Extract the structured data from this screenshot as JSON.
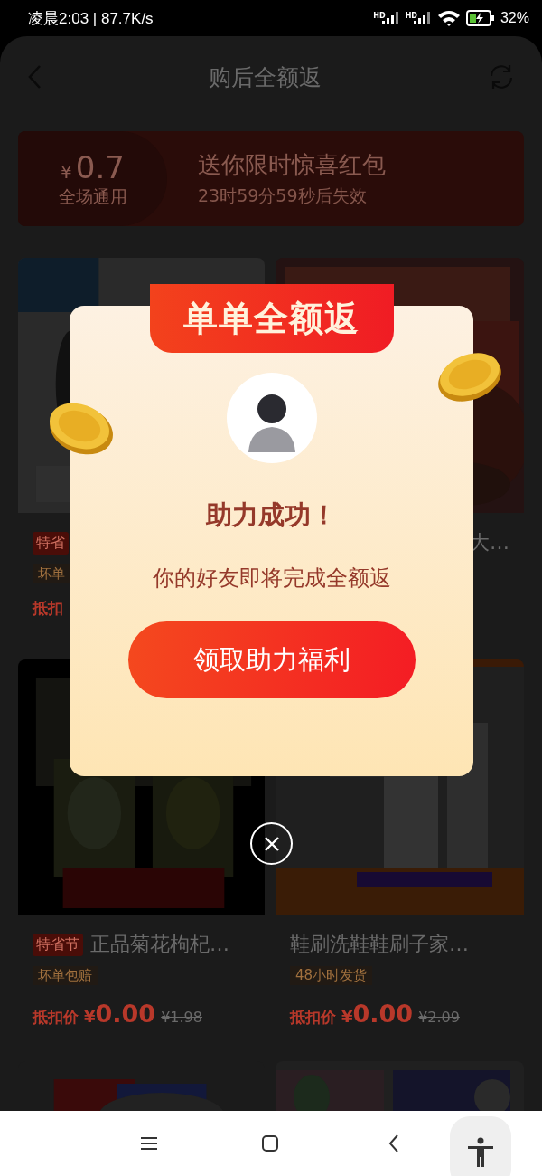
{
  "status_bar": {
    "time_speed": "凌晨2:03 | 87.7K/s",
    "signals": [
      "HD",
      "HD"
    ],
    "battery": "32%"
  },
  "header": {
    "title": "购后全额返"
  },
  "coupon": {
    "currency": "¥",
    "amount": "0.7",
    "scope": "全场通用",
    "title": "送你限时惊喜红包",
    "countdown": "23时59分59秒后失效"
  },
  "products": [
    {
      "kind": "covered",
      "tag": "特省",
      "shipping": "坏单",
      "price_label": "抵扣"
    },
    {
      "kind": "covered",
      "title": "大…"
    },
    {
      "kind": "full",
      "tag": "特省节",
      "title": "正品菊花枸杞…",
      "shipping": "坏单包赔",
      "price_label": "抵扣价",
      "currency": "¥",
      "price": "0.00",
      "original_price": "¥1.98"
    },
    {
      "kind": "full",
      "title": "鞋刷洗鞋鞋刷子家…",
      "shipping": "48小时发货",
      "price_label": "抵扣价",
      "currency": "¥",
      "price": "0.00",
      "original_price": "¥2.09"
    },
    {
      "kind": "cut"
    },
    {
      "kind": "cut"
    }
  ],
  "modal": {
    "ribbon": "单单全额返",
    "heading": "助力成功！",
    "message": "你的好友即将完成全额返",
    "button": "领取助力福利"
  }
}
